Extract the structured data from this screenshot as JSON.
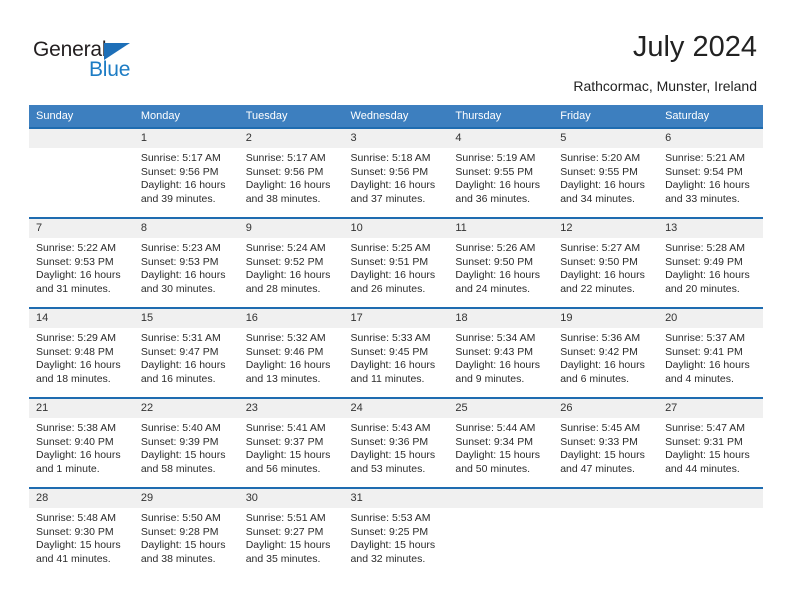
{
  "brand": {
    "name_primary": "General",
    "name_secondary": "Blue",
    "triangle_color": "#1d6fb8",
    "secondary_color": "#1d7cc4"
  },
  "header": {
    "title": "July 2024",
    "location": "Rathcormac, Munster, Ireland"
  },
  "theme": {
    "header_bar": "#3d7fbf",
    "week_rule": "#1f6cb0",
    "day_band": "#f0f0f0",
    "text": "#2b2b2b"
  },
  "calendar": {
    "weekday_headers": [
      "Sunday",
      "Monday",
      "Tuesday",
      "Wednesday",
      "Thursday",
      "Friday",
      "Saturday"
    ],
    "weeks": [
      [
        {
          "day": "",
          "lines": []
        },
        {
          "day": "1",
          "lines": [
            "Sunrise: 5:17 AM",
            "Sunset: 9:56 PM",
            "Daylight: 16 hours",
            "and 39 minutes."
          ]
        },
        {
          "day": "2",
          "lines": [
            "Sunrise: 5:17 AM",
            "Sunset: 9:56 PM",
            "Daylight: 16 hours",
            "and 38 minutes."
          ]
        },
        {
          "day": "3",
          "lines": [
            "Sunrise: 5:18 AM",
            "Sunset: 9:56 PM",
            "Daylight: 16 hours",
            "and 37 minutes."
          ]
        },
        {
          "day": "4",
          "lines": [
            "Sunrise: 5:19 AM",
            "Sunset: 9:55 PM",
            "Daylight: 16 hours",
            "and 36 minutes."
          ]
        },
        {
          "day": "5",
          "lines": [
            "Sunrise: 5:20 AM",
            "Sunset: 9:55 PM",
            "Daylight: 16 hours",
            "and 34 minutes."
          ]
        },
        {
          "day": "6",
          "lines": [
            "Sunrise: 5:21 AM",
            "Sunset: 9:54 PM",
            "Daylight: 16 hours",
            "and 33 minutes."
          ]
        }
      ],
      [
        {
          "day": "7",
          "lines": [
            "Sunrise: 5:22 AM",
            "Sunset: 9:53 PM",
            "Daylight: 16 hours",
            "and 31 minutes."
          ]
        },
        {
          "day": "8",
          "lines": [
            "Sunrise: 5:23 AM",
            "Sunset: 9:53 PM",
            "Daylight: 16 hours",
            "and 30 minutes."
          ]
        },
        {
          "day": "9",
          "lines": [
            "Sunrise: 5:24 AM",
            "Sunset: 9:52 PM",
            "Daylight: 16 hours",
            "and 28 minutes."
          ]
        },
        {
          "day": "10",
          "lines": [
            "Sunrise: 5:25 AM",
            "Sunset: 9:51 PM",
            "Daylight: 16 hours",
            "and 26 minutes."
          ]
        },
        {
          "day": "11",
          "lines": [
            "Sunrise: 5:26 AM",
            "Sunset: 9:50 PM",
            "Daylight: 16 hours",
            "and 24 minutes."
          ]
        },
        {
          "day": "12",
          "lines": [
            "Sunrise: 5:27 AM",
            "Sunset: 9:50 PM",
            "Daylight: 16 hours",
            "and 22 minutes."
          ]
        },
        {
          "day": "13",
          "lines": [
            "Sunrise: 5:28 AM",
            "Sunset: 9:49 PM",
            "Daylight: 16 hours",
            "and 20 minutes."
          ]
        }
      ],
      [
        {
          "day": "14",
          "lines": [
            "Sunrise: 5:29 AM",
            "Sunset: 9:48 PM",
            "Daylight: 16 hours",
            "and 18 minutes."
          ]
        },
        {
          "day": "15",
          "lines": [
            "Sunrise: 5:31 AM",
            "Sunset: 9:47 PM",
            "Daylight: 16 hours",
            "and 16 minutes."
          ]
        },
        {
          "day": "16",
          "lines": [
            "Sunrise: 5:32 AM",
            "Sunset: 9:46 PM",
            "Daylight: 16 hours",
            "and 13 minutes."
          ]
        },
        {
          "day": "17",
          "lines": [
            "Sunrise: 5:33 AM",
            "Sunset: 9:45 PM",
            "Daylight: 16 hours",
            "and 11 minutes."
          ]
        },
        {
          "day": "18",
          "lines": [
            "Sunrise: 5:34 AM",
            "Sunset: 9:43 PM",
            "Daylight: 16 hours",
            "and 9 minutes."
          ]
        },
        {
          "day": "19",
          "lines": [
            "Sunrise: 5:36 AM",
            "Sunset: 9:42 PM",
            "Daylight: 16 hours",
            "and 6 minutes."
          ]
        },
        {
          "day": "20",
          "lines": [
            "Sunrise: 5:37 AM",
            "Sunset: 9:41 PM",
            "Daylight: 16 hours",
            "and 4 minutes."
          ]
        }
      ],
      [
        {
          "day": "21",
          "lines": [
            "Sunrise: 5:38 AM",
            "Sunset: 9:40 PM",
            "Daylight: 16 hours",
            "and 1 minute."
          ]
        },
        {
          "day": "22",
          "lines": [
            "Sunrise: 5:40 AM",
            "Sunset: 9:39 PM",
            "Daylight: 15 hours",
            "and 58 minutes."
          ]
        },
        {
          "day": "23",
          "lines": [
            "Sunrise: 5:41 AM",
            "Sunset: 9:37 PM",
            "Daylight: 15 hours",
            "and 56 minutes."
          ]
        },
        {
          "day": "24",
          "lines": [
            "Sunrise: 5:43 AM",
            "Sunset: 9:36 PM",
            "Daylight: 15 hours",
            "and 53 minutes."
          ]
        },
        {
          "day": "25",
          "lines": [
            "Sunrise: 5:44 AM",
            "Sunset: 9:34 PM",
            "Daylight: 15 hours",
            "and 50 minutes."
          ]
        },
        {
          "day": "26",
          "lines": [
            "Sunrise: 5:45 AM",
            "Sunset: 9:33 PM",
            "Daylight: 15 hours",
            "and 47 minutes."
          ]
        },
        {
          "day": "27",
          "lines": [
            "Sunrise: 5:47 AM",
            "Sunset: 9:31 PM",
            "Daylight: 15 hours",
            "and 44 minutes."
          ]
        }
      ],
      [
        {
          "day": "28",
          "lines": [
            "Sunrise: 5:48 AM",
            "Sunset: 9:30 PM",
            "Daylight: 15 hours",
            "and 41 minutes."
          ]
        },
        {
          "day": "29",
          "lines": [
            "Sunrise: 5:50 AM",
            "Sunset: 9:28 PM",
            "Daylight: 15 hours",
            "and 38 minutes."
          ]
        },
        {
          "day": "30",
          "lines": [
            "Sunrise: 5:51 AM",
            "Sunset: 9:27 PM",
            "Daylight: 15 hours",
            "and 35 minutes."
          ]
        },
        {
          "day": "31",
          "lines": [
            "Sunrise: 5:53 AM",
            "Sunset: 9:25 PM",
            "Daylight: 15 hours",
            "and 32 minutes."
          ]
        },
        {
          "day": "",
          "lines": []
        },
        {
          "day": "",
          "lines": []
        },
        {
          "day": "",
          "lines": []
        }
      ]
    ]
  }
}
